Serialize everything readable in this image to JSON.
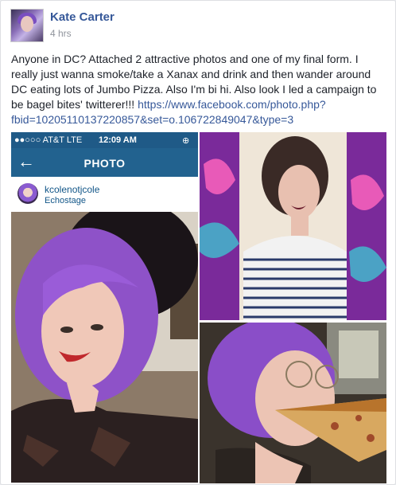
{
  "post": {
    "author": "Kate Carter",
    "time": "4 hrs",
    "text": "Anyone in DC? Attached 2 attractive photos and one of my final form. I really just wanna smoke/take a Xanax and drink and then wander around DC eating lots of Jumbo Pizza. Also I'm bi hi. Also look I led a campaign to be bagel bites' twitterer!!! ",
    "link": "https://www.facebook.com/photo.php?fbid=10205110137220857&set=o.106722849047&type=3"
  },
  "instagram": {
    "carrier": "●●○○○ AT&T  LTE",
    "clock": "12:09 AM",
    "battery": "⊕ ▭",
    "back_glyph": "←",
    "title": "PHOTO",
    "username": "kcolenotjcole",
    "location": "Echostage"
  },
  "icons": {
    "back": "back-arrow-icon"
  }
}
